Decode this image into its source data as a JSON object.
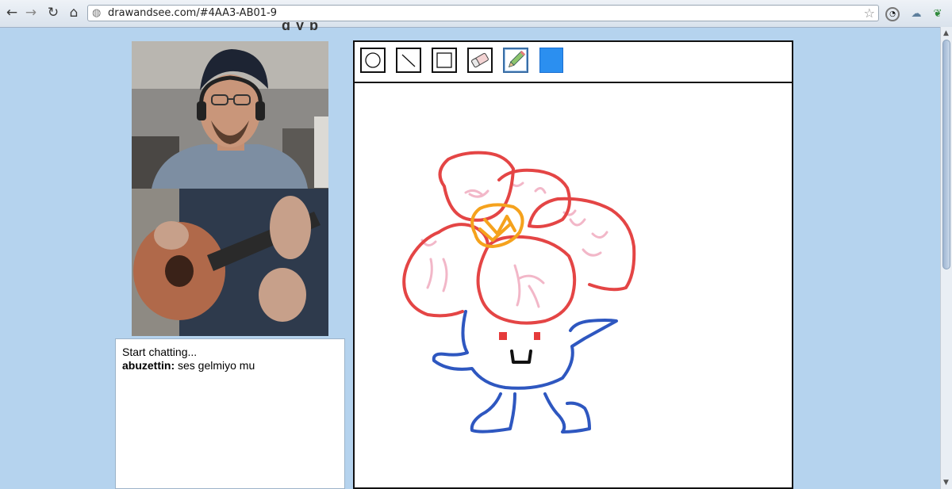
{
  "browser": {
    "url": "drawandsee.com/#4AA3-AB01-9",
    "icons": [
      "back-icon",
      "forward-icon",
      "reload-icon",
      "home-icon",
      "globe-icon",
      "star-icon",
      "clock-extension-icon",
      "cloud-extension-icon",
      "leaf-extension-icon"
    ]
  },
  "page": {
    "heading_fragment": "g                y                    p",
    "colors": {
      "background": "#b5d3ee",
      "selected_color": "#2b8ff0"
    }
  },
  "chat": {
    "intro": "Start chatting...",
    "messages": [
      {
        "user": "abuzettin:",
        "text": " ses gelmiyo mu"
      }
    ]
  },
  "drawing_tools": {
    "tools": [
      {
        "name": "circle-tool",
        "icon": "circle-icon"
      },
      {
        "name": "line-tool",
        "icon": "line-icon"
      },
      {
        "name": "rectangle-tool",
        "icon": "square-icon"
      },
      {
        "name": "eraser-tool",
        "icon": "eraser-icon"
      },
      {
        "name": "pencil-tool",
        "icon": "pencil-icon",
        "selected": true
      }
    ],
    "current_color": "#2b8ff0"
  }
}
